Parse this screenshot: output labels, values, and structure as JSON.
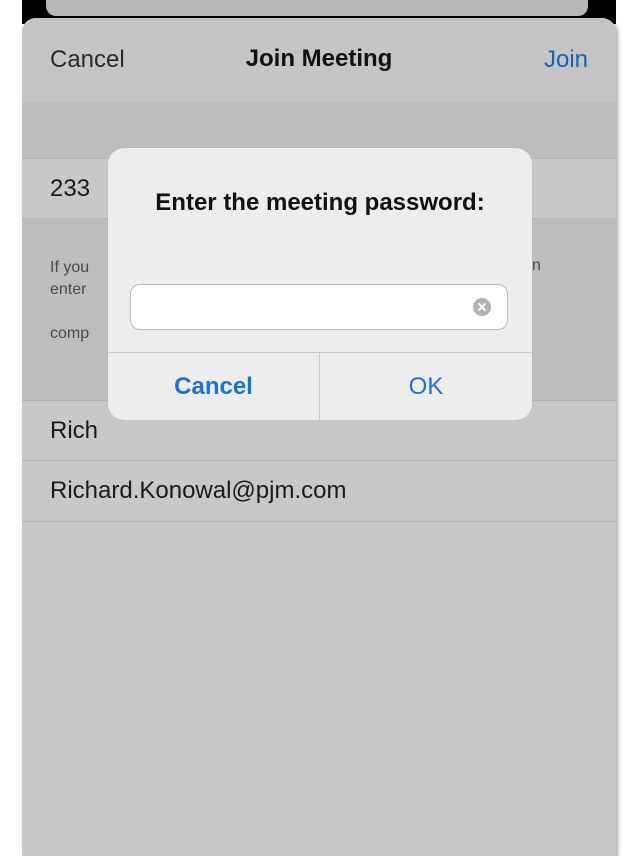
{
  "nav": {
    "cancel_label": "Cancel",
    "title": "Join Meeting",
    "join_label": "Join"
  },
  "form": {
    "meeting_id": "233",
    "info_lines": "If you\nenter\n\ncomp",
    "info_right_fragment": "n",
    "name": "Rich",
    "email": "Richard.Konowal@pjm.com"
  },
  "alert": {
    "title": "Enter the meeting password:",
    "password_value": "",
    "cancel_label": "Cancel",
    "ok_label": "OK"
  },
  "colors": {
    "link_blue": "#1f5fb0",
    "alert_button_blue": "#1f6fd6",
    "overlay_gray": "#c8c8c8"
  },
  "icons": {
    "clear": "clear-circle-x-icon"
  }
}
